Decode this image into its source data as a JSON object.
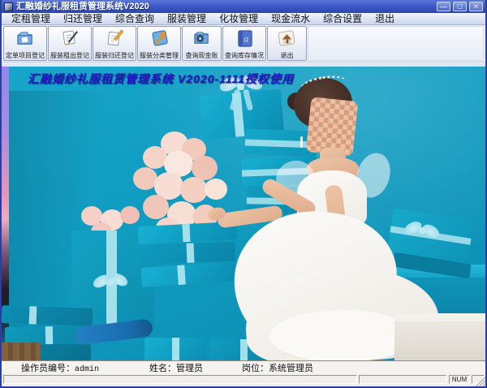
{
  "window": {
    "title": "汇融婚纱礼服租赁管理系统V2020",
    "controls": [
      {
        "name": "minimize",
        "glyph": "—"
      },
      {
        "name": "maximize",
        "glyph": "□"
      },
      {
        "name": "close",
        "glyph": "✕"
      }
    ]
  },
  "menu": {
    "items": [
      "定租管理",
      "归还管理",
      "综合查询",
      "服装管理",
      "化妆管理",
      "现金流水",
      "综合设置",
      "退出"
    ]
  },
  "toolbar": {
    "buttons": [
      {
        "label": "定单项目登记",
        "icon": "order-folder-icon"
      },
      {
        "label": "服装租出登记",
        "icon": "rent-out-document-icon"
      },
      {
        "label": "服装归还登记",
        "icon": "return-document-icon"
      },
      {
        "label": "服装分类管理",
        "icon": "category-tool-icon"
      },
      {
        "label": "查询现金账",
        "icon": "cash-gear-icon"
      },
      {
        "label": "查询库存情况",
        "icon": "stock-book-icon"
      },
      {
        "label": "退出",
        "icon": "exit-home-icon"
      }
    ]
  },
  "banner": {
    "text": "汇融婚纱礼服租赁管理系统 V2020-1111授权使用"
  },
  "photo": {
    "scene": "bride in white gown seated among teal gift boxes with pink bouquets"
  },
  "status_bar": {
    "operator": {
      "label": "操作员编号：",
      "value": "admin"
    },
    "name": {
      "label": "姓名：",
      "value": "管理员"
    },
    "position": {
      "label": "岗位：",
      "value": "系统管理员"
    },
    "num_lock": "NUM"
  },
  "colors": {
    "titlebar": "#3a56c0",
    "teal_background": "#109bc0",
    "box_teal": "#109dc2",
    "ribbon": "#a9e2ee",
    "banner_text": "#2114c4",
    "dress_white": "#f6f3ef"
  }
}
